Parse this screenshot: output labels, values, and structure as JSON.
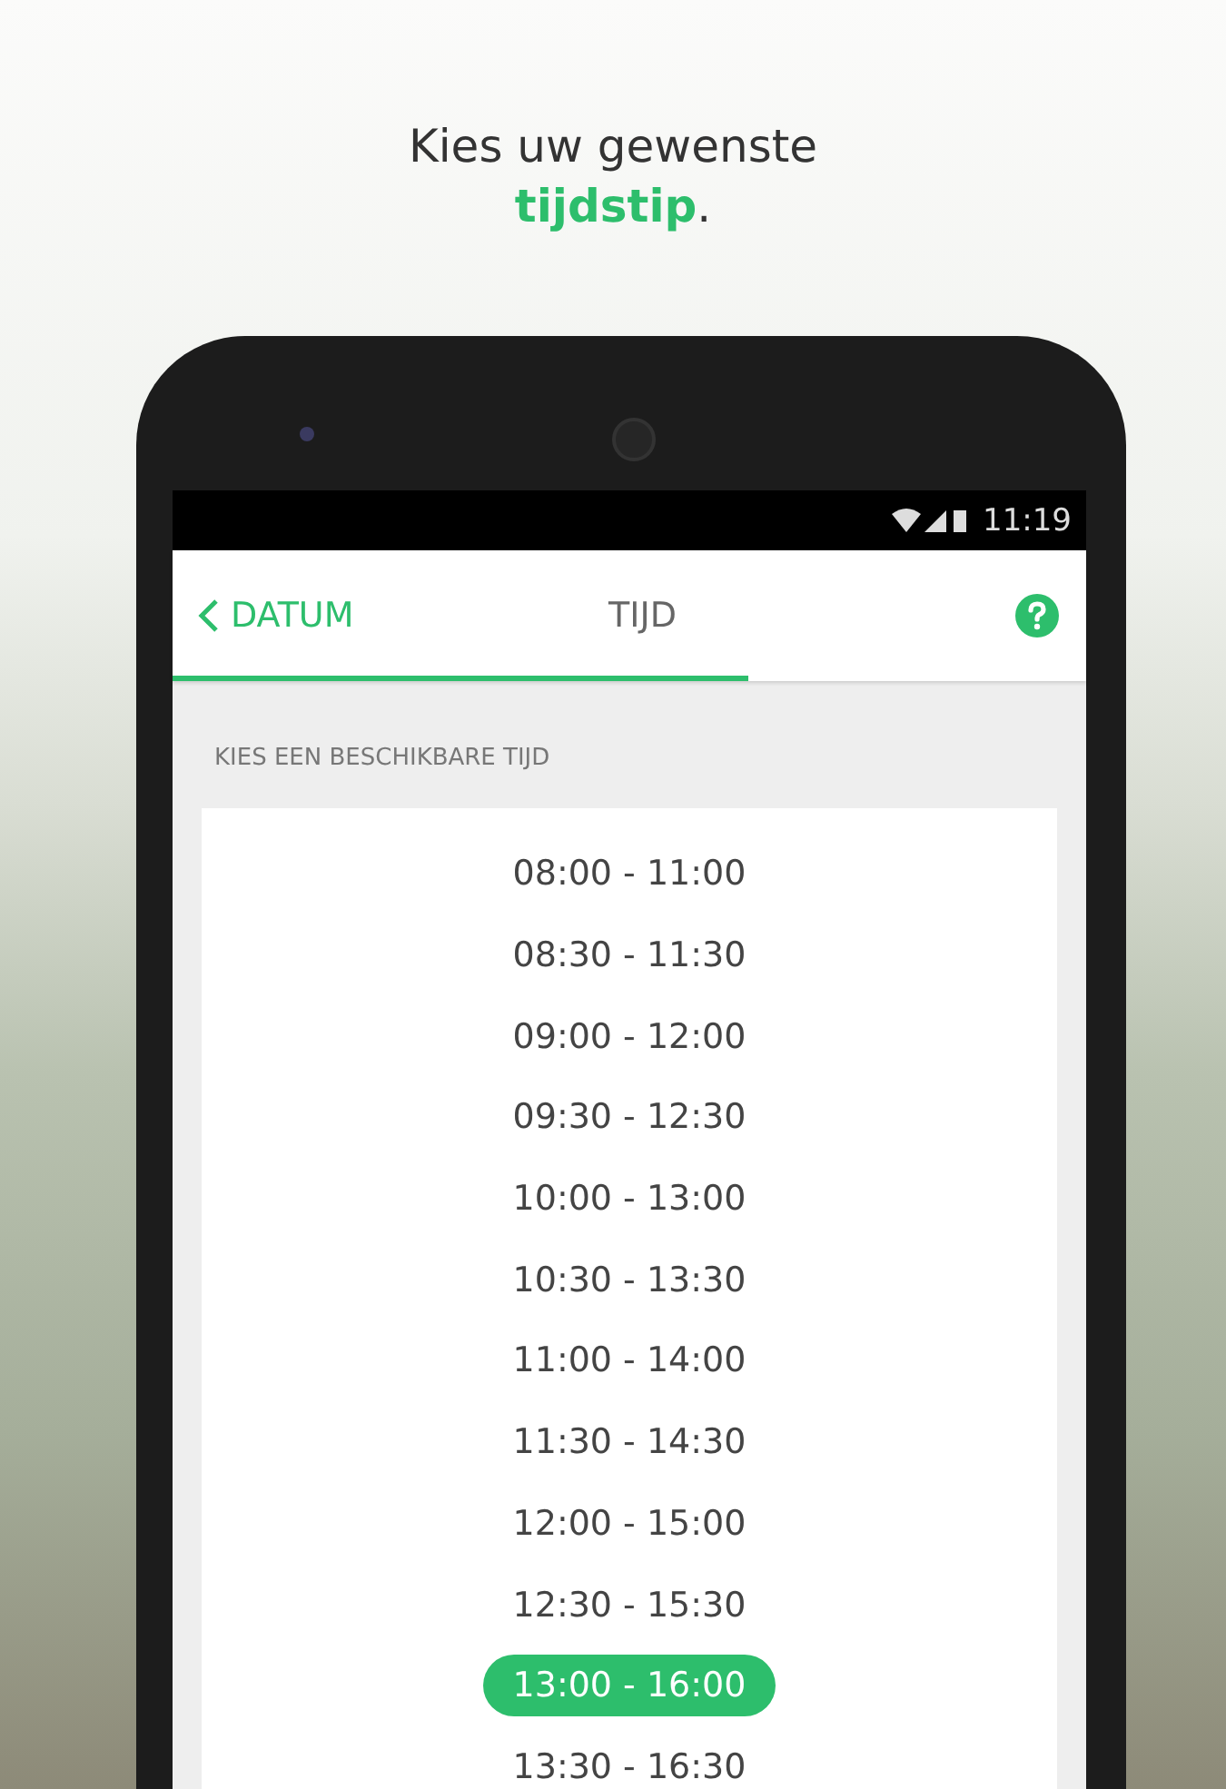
{
  "headline": {
    "line1": "Kies uw gewenste",
    "line2": "**tijdstip**."
  },
  "status_bar": {
    "time": "11:19"
  },
  "app_bar": {
    "back_label": "DATUM",
    "title": "TIJD",
    "progress": {
      "level": 0.63
    }
  },
  "section_label": "KIES EEN BESCHIKBARE TIJD",
  "slots": [
    {
      "label": "08:00 - 11:00",
      "selected": false
    },
    {
      "label": "08:30 - 11:30",
      "selected": false
    },
    {
      "label": "09:00 - 12:00",
      "selected": false
    },
    {
      "label": "09:30 - 12:30",
      "selected": false
    },
    {
      "label": "10:00 - 13:00",
      "selected": false
    },
    {
      "label": "10:30 - 13:30",
      "selected": false
    },
    {
      "label": "11:00 - 14:00",
      "selected": false
    },
    {
      "label": "11:30 - 14:30",
      "selected": false
    },
    {
      "label": "12:00 - 15:00",
      "selected": false
    },
    {
      "label": "12:30 - 15:30",
      "selected": false
    },
    {
      "label": "13:00 - 16:00",
      "selected": true
    },
    {
      "label": "13:30 - 16:30",
      "selected": false
    }
  ]
}
